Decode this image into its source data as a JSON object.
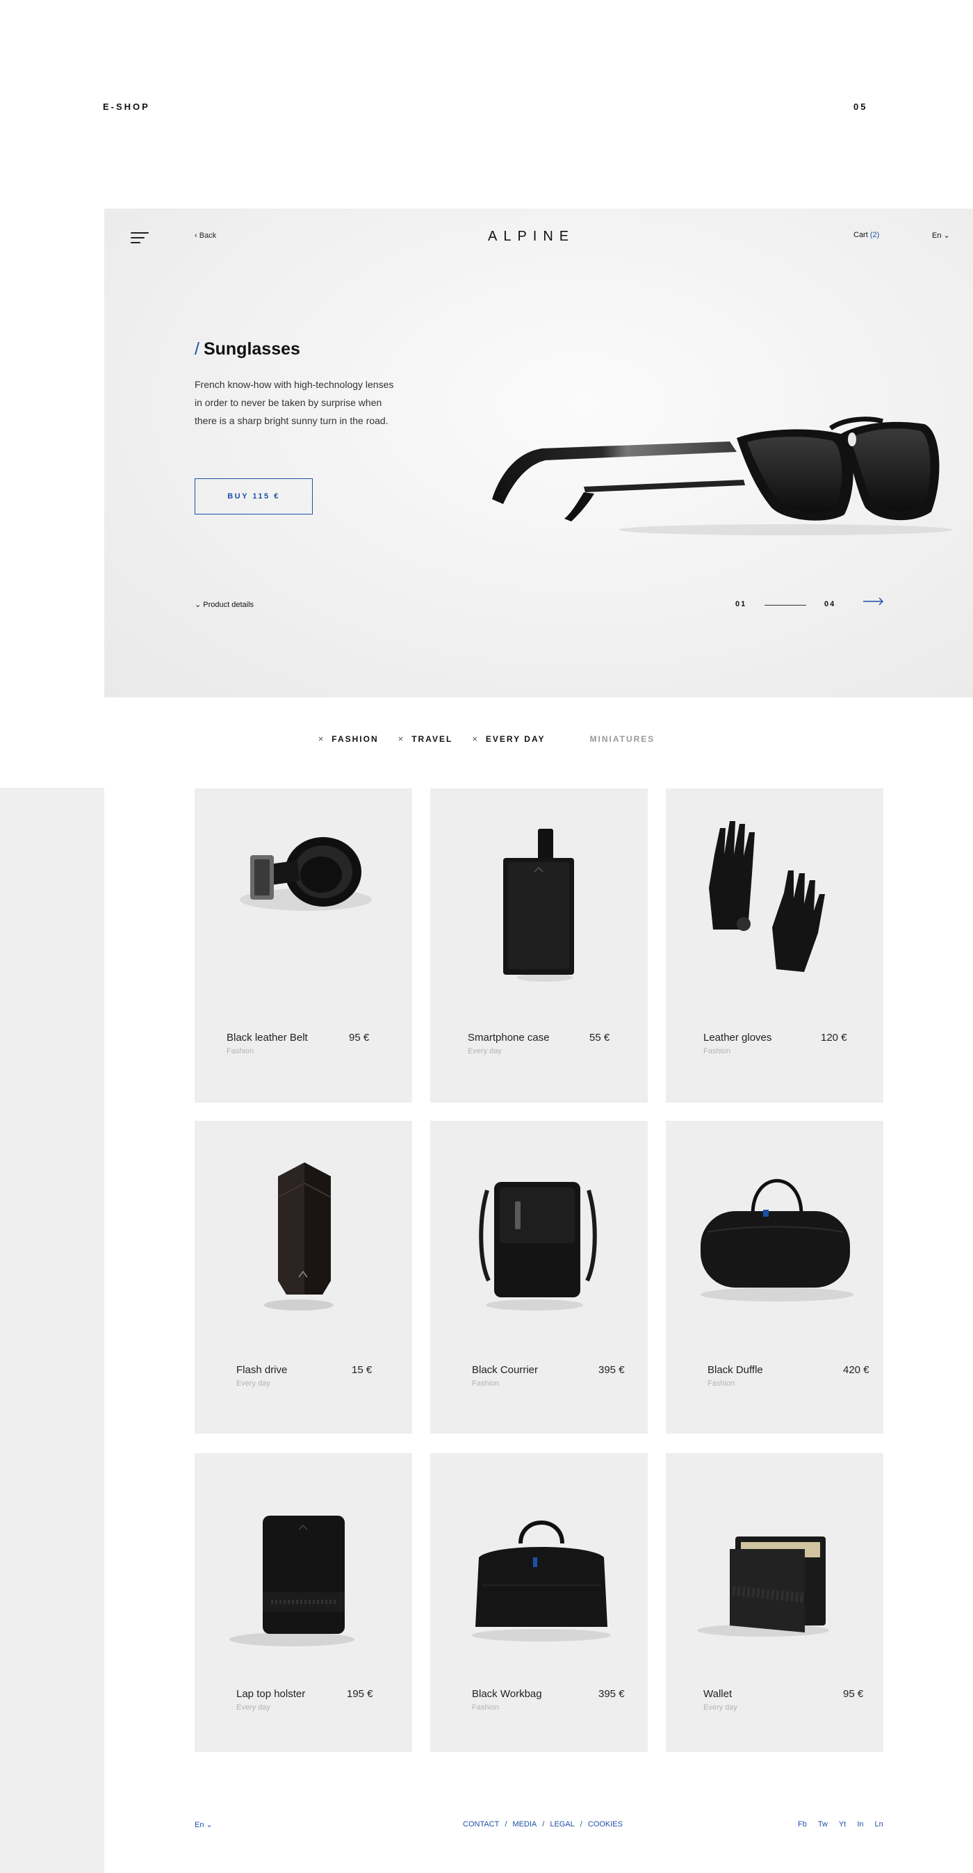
{
  "page": {
    "section_label": "E-SHOP",
    "page_number": "05"
  },
  "hero": {
    "back_label": "Back",
    "logo": "ALPINE",
    "cart_label": "Cart",
    "cart_count": "(2)",
    "language": "En",
    "slash": "/",
    "title": "Sunglasses",
    "description": "French know-how with high-technology lenses in order to never be taken by surprise when there is a sharp bright sunny turn in the road.",
    "buy_label": "BUY 115 €",
    "details_label": "Product details",
    "pager_current": "01",
    "pager_total": "04"
  },
  "filters": [
    {
      "label": "FASHION",
      "active": true
    },
    {
      "label": "TRAVEL",
      "active": true
    },
    {
      "label": "EVERY DAY",
      "active": true
    },
    {
      "label": "MINIATURES",
      "active": false
    }
  ],
  "products": [
    {
      "name": "Black leather Belt",
      "price": "95 €",
      "category": "Fashion",
      "icon": "belt"
    },
    {
      "name": "Smartphone case",
      "price": "55 €",
      "category": "Every day",
      "icon": "phone-case"
    },
    {
      "name": "Leather gloves",
      "price": "120 €",
      "category": "Fashion",
      "icon": "gloves"
    },
    {
      "name": "Flash drive",
      "price": "15 €",
      "category": "Every day",
      "icon": "flash-drive"
    },
    {
      "name": "Black Courrier",
      "price": "395 €",
      "category": "Fashion",
      "icon": "messenger-bag"
    },
    {
      "name": "Black Duffle",
      "price": "420 €",
      "category": "Fashion",
      "icon": "duffle-bag"
    },
    {
      "name": "Lap top holster",
      "price": "195 €",
      "category": "Every day",
      "icon": "laptop-holster"
    },
    {
      "name": "Black Workbag",
      "price": "395 €",
      "category": "Fashion",
      "icon": "workbag"
    },
    {
      "name": "Wallet",
      "price": "95 €",
      "category": "Every day",
      "icon": "wallet"
    }
  ],
  "footer": {
    "language": "En",
    "links": [
      "CONTACT",
      "MEDIA",
      "LEGAL",
      "COOKIES"
    ],
    "social": [
      "Fb",
      "Tw",
      "Yt",
      "In",
      "Ln"
    ]
  },
  "colors": {
    "accent": "#1d4fa8",
    "card_bg": "#eeeeee",
    "side_grey": "#efefef"
  }
}
